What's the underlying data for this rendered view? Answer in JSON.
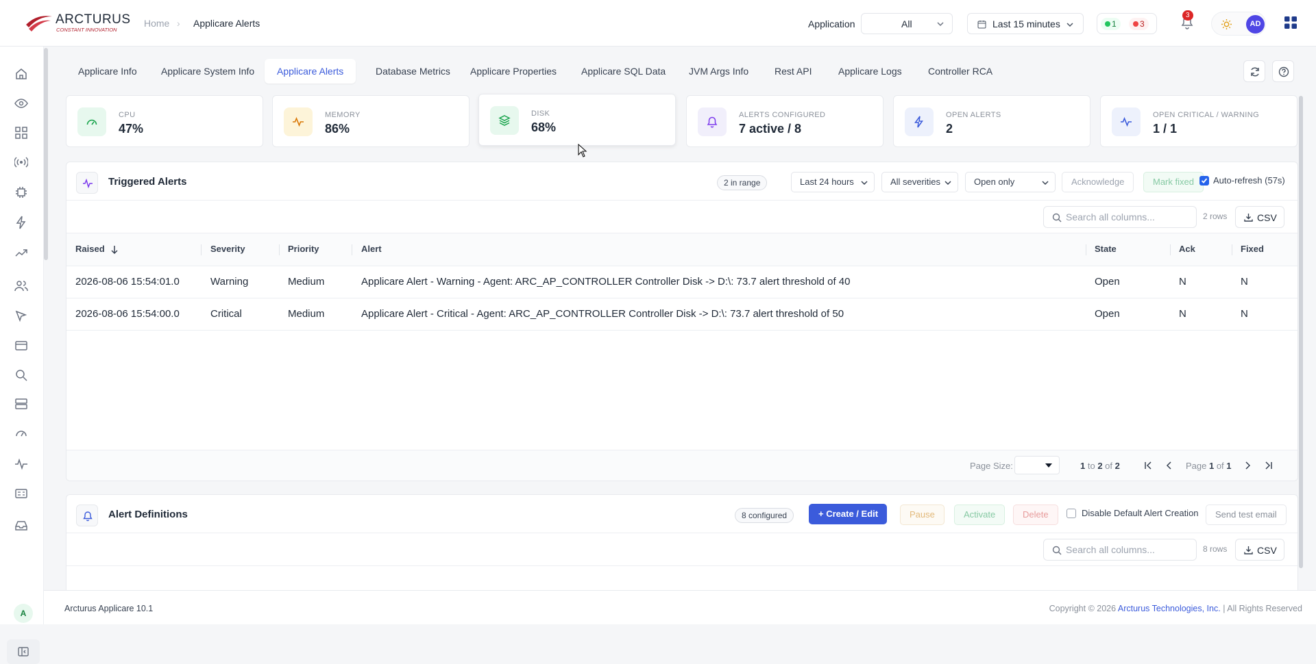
{
  "brand": {
    "name": "ARCTURUS",
    "tagline": "CONSTANT INNOVATION"
  },
  "breadcrumb": {
    "home": "Home",
    "separator": "›",
    "current": "Applicare Alerts"
  },
  "header": {
    "application_label": "Application",
    "application_value": "All",
    "time_range": "Last 15 minutes",
    "status_ok_count": "1",
    "status_alert_count": "3",
    "notification_count": "3",
    "avatar_initials": "AD"
  },
  "tabs": [
    "Applicare Info",
    "Applicare System Info",
    "Applicare Alerts",
    "Database Metrics",
    "Applicare Properties",
    "Applicare SQL Data",
    "JVM Args Info",
    "Rest API",
    "Applicare Logs",
    "Controller RCA"
  ],
  "active_tab": "Applicare Alerts",
  "cards": [
    {
      "label": "CPU",
      "value": "47%",
      "icon": "gauge-icon"
    },
    {
      "label": "MEMORY",
      "value": "86%",
      "icon": "pulse-icon"
    },
    {
      "label": "DISK",
      "value": "68%",
      "icon": "layers-icon"
    },
    {
      "label": "ALERTS CONFIGURED",
      "value": "7 active / 8",
      "icon": "bell-icon"
    },
    {
      "label": "OPEN ALERTS",
      "value": "2",
      "icon": "bolt-icon"
    },
    {
      "label": "OPEN CRITICAL / WARNING",
      "value": "1 / 1",
      "icon": "pulse-icon"
    }
  ],
  "triggered": {
    "title": "Triggered Alerts",
    "range_chip": "2 in range",
    "period": "Last 24 hours",
    "severity": "All severities",
    "state_filter": "Open only",
    "acknowledge": "Acknowledge",
    "mark_fixed": "Mark fixed",
    "auto_refresh": "Auto-refresh (57s)",
    "search_placeholder": "Search all columns...",
    "rows_count": "2 rows",
    "csv": "CSV",
    "columns": [
      "Raised",
      "Severity",
      "Priority",
      "Alert",
      "State",
      "Ack",
      "Fixed"
    ],
    "rows": [
      [
        "2026-08-06 15:54:01.0",
        "Warning",
        "Medium",
        "Applicare Alert - Warning - Agent: ARC_AP_CONTROLLER Controller Disk -> D:\\: 73.7 alert threshold of 40",
        "Open",
        "N",
        "N"
      ],
      [
        "2026-08-06 15:54:00.0",
        "Critical",
        "Medium",
        "Applicare Alert - Critical - Agent: ARC_AP_CONTROLLER Controller Disk -> D:\\: 73.7 alert threshold of 50",
        "Open",
        "N",
        "N"
      ]
    ],
    "pager": {
      "page_size_label": "Page Size:",
      "from": "1",
      "to": "2",
      "total": "2",
      "page": "1",
      "pages": "1"
    }
  },
  "definitions": {
    "title": "Alert Definitions",
    "configured_chip": "8 configured",
    "create": "Create / Edit",
    "pause": "Pause",
    "activate": "Activate",
    "delete": "Delete",
    "disable_default": "Disable Default Alert Creation",
    "send_test": "Send test email",
    "search_placeholder": "Search all columns...",
    "rows_count": "8 rows",
    "csv": "CSV"
  },
  "sidebar_initial": "A",
  "footer": {
    "version": "Arcturus Applicare 10.1",
    "copyright_prefix": "Copyright © 2026",
    "company": "Arcturus Technologies, Inc.",
    "rights": "| All Rights Reserved"
  },
  "colors": {
    "accent": "#3b5bdb",
    "ok": "#22c55e",
    "alert": "#ef4444",
    "brand_red": "#b11f2c"
  }
}
